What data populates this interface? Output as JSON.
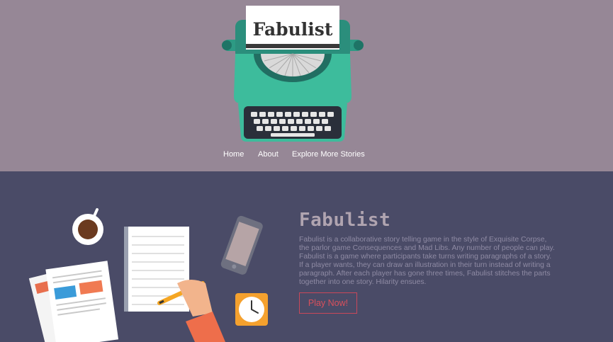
{
  "header": {
    "logo_text": "Fabulist",
    "background": "#968796"
  },
  "nav": {
    "items": [
      {
        "label": "Home"
      },
      {
        "label": "About"
      },
      {
        "label": "Explore More Stories"
      }
    ]
  },
  "hero": {
    "background": "#4a4b67",
    "title": "Fabulist",
    "description": "Fabulist is a collaborative story telling game in the style of Exquisite Corpse, the parlor game Consequences and Mad Libs. Any number of people can play. Fabulist is a game where participants take turns writing paragraphs of a story. If a player wants, they can draw an illustration in their turn instead of writing a paragraph. After each player has gone three times, Fabulist stitches the parts together into one story. Hilarity ensues.",
    "cta_label": "Play Now!",
    "accent": "#d9505c"
  },
  "illustration": {
    "icons": [
      "coffee-cup-icon",
      "documents-icon",
      "notepad-icon",
      "pencil-icon",
      "smartphone-icon",
      "clock-icon"
    ]
  }
}
